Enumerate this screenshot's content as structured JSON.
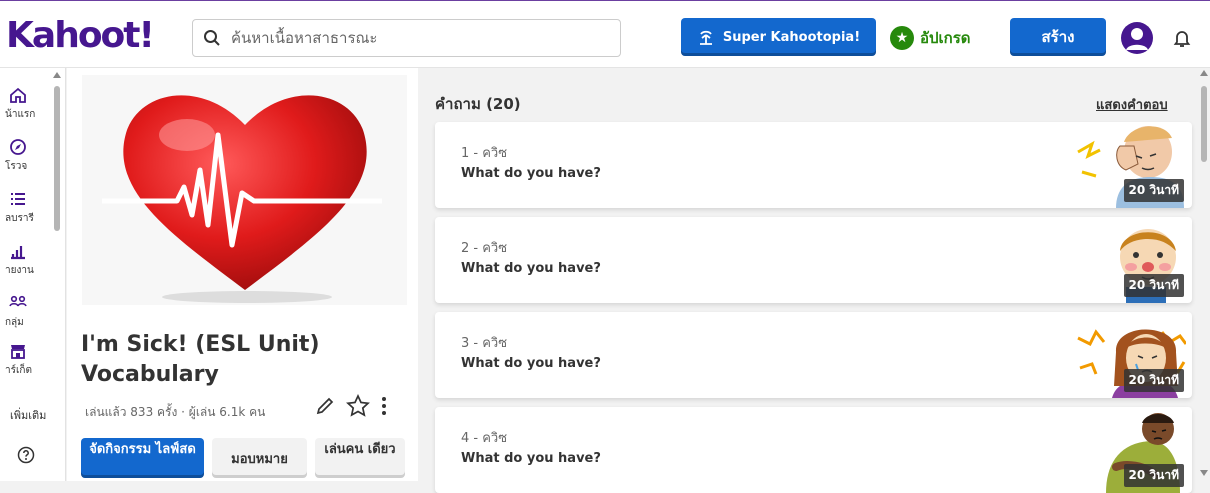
{
  "header": {
    "logo": "Kahoot!",
    "search_placeholder": "ค้นหาเนื้อหาสาธารณะ",
    "super_label": "Super Kahootopia!",
    "upgrade_label": "อัปเกรด",
    "create_label": "สร้าง"
  },
  "sidebar": {
    "items": [
      {
        "label": "น้าแรก",
        "icon": "home-icon"
      },
      {
        "label": "โรวจ",
        "icon": "compass-icon"
      },
      {
        "label": "ลบรารี",
        "icon": "list-icon"
      },
      {
        "label": "ายงาน",
        "icon": "bar-chart-icon"
      },
      {
        "label": "กลุ่ม",
        "icon": "group-icon"
      },
      {
        "label": "าร์เก็ต",
        "icon": "store-icon"
      }
    ],
    "more_label": "เพิ่มเติม",
    "help_icon": "help-icon"
  },
  "kahoot": {
    "title": "I'm Sick! (ESL Unit) Vocabulary",
    "stats": "เล่นแล้ว 833 ครั้ง · ผู้เล่น 6.1k คน",
    "host_label": "จัดกิจกรรม ไลฟ์สด",
    "assign_label": "มอบหมาย",
    "solo_label": "เล่นคน เดียว"
  },
  "questions": {
    "header": "คำถาม (20)",
    "show_answers": "แสดงคำตอบ",
    "items": [
      {
        "number": "1 - ควิซ",
        "text": "What do you have?",
        "time": "20 วินาที"
      },
      {
        "number": "2 - ควิซ",
        "text": "What do you have?",
        "time": "20 วินาที"
      },
      {
        "number": "3 - ควิซ",
        "text": "What do you have?",
        "time": "20 วินาที"
      },
      {
        "number": "4 - ควิซ",
        "text": "What do you have?",
        "time": "20 วินาที"
      }
    ]
  },
  "colors": {
    "brand": "#46178f",
    "primary_button": "#1368ce",
    "upgrade": "#26890c"
  }
}
